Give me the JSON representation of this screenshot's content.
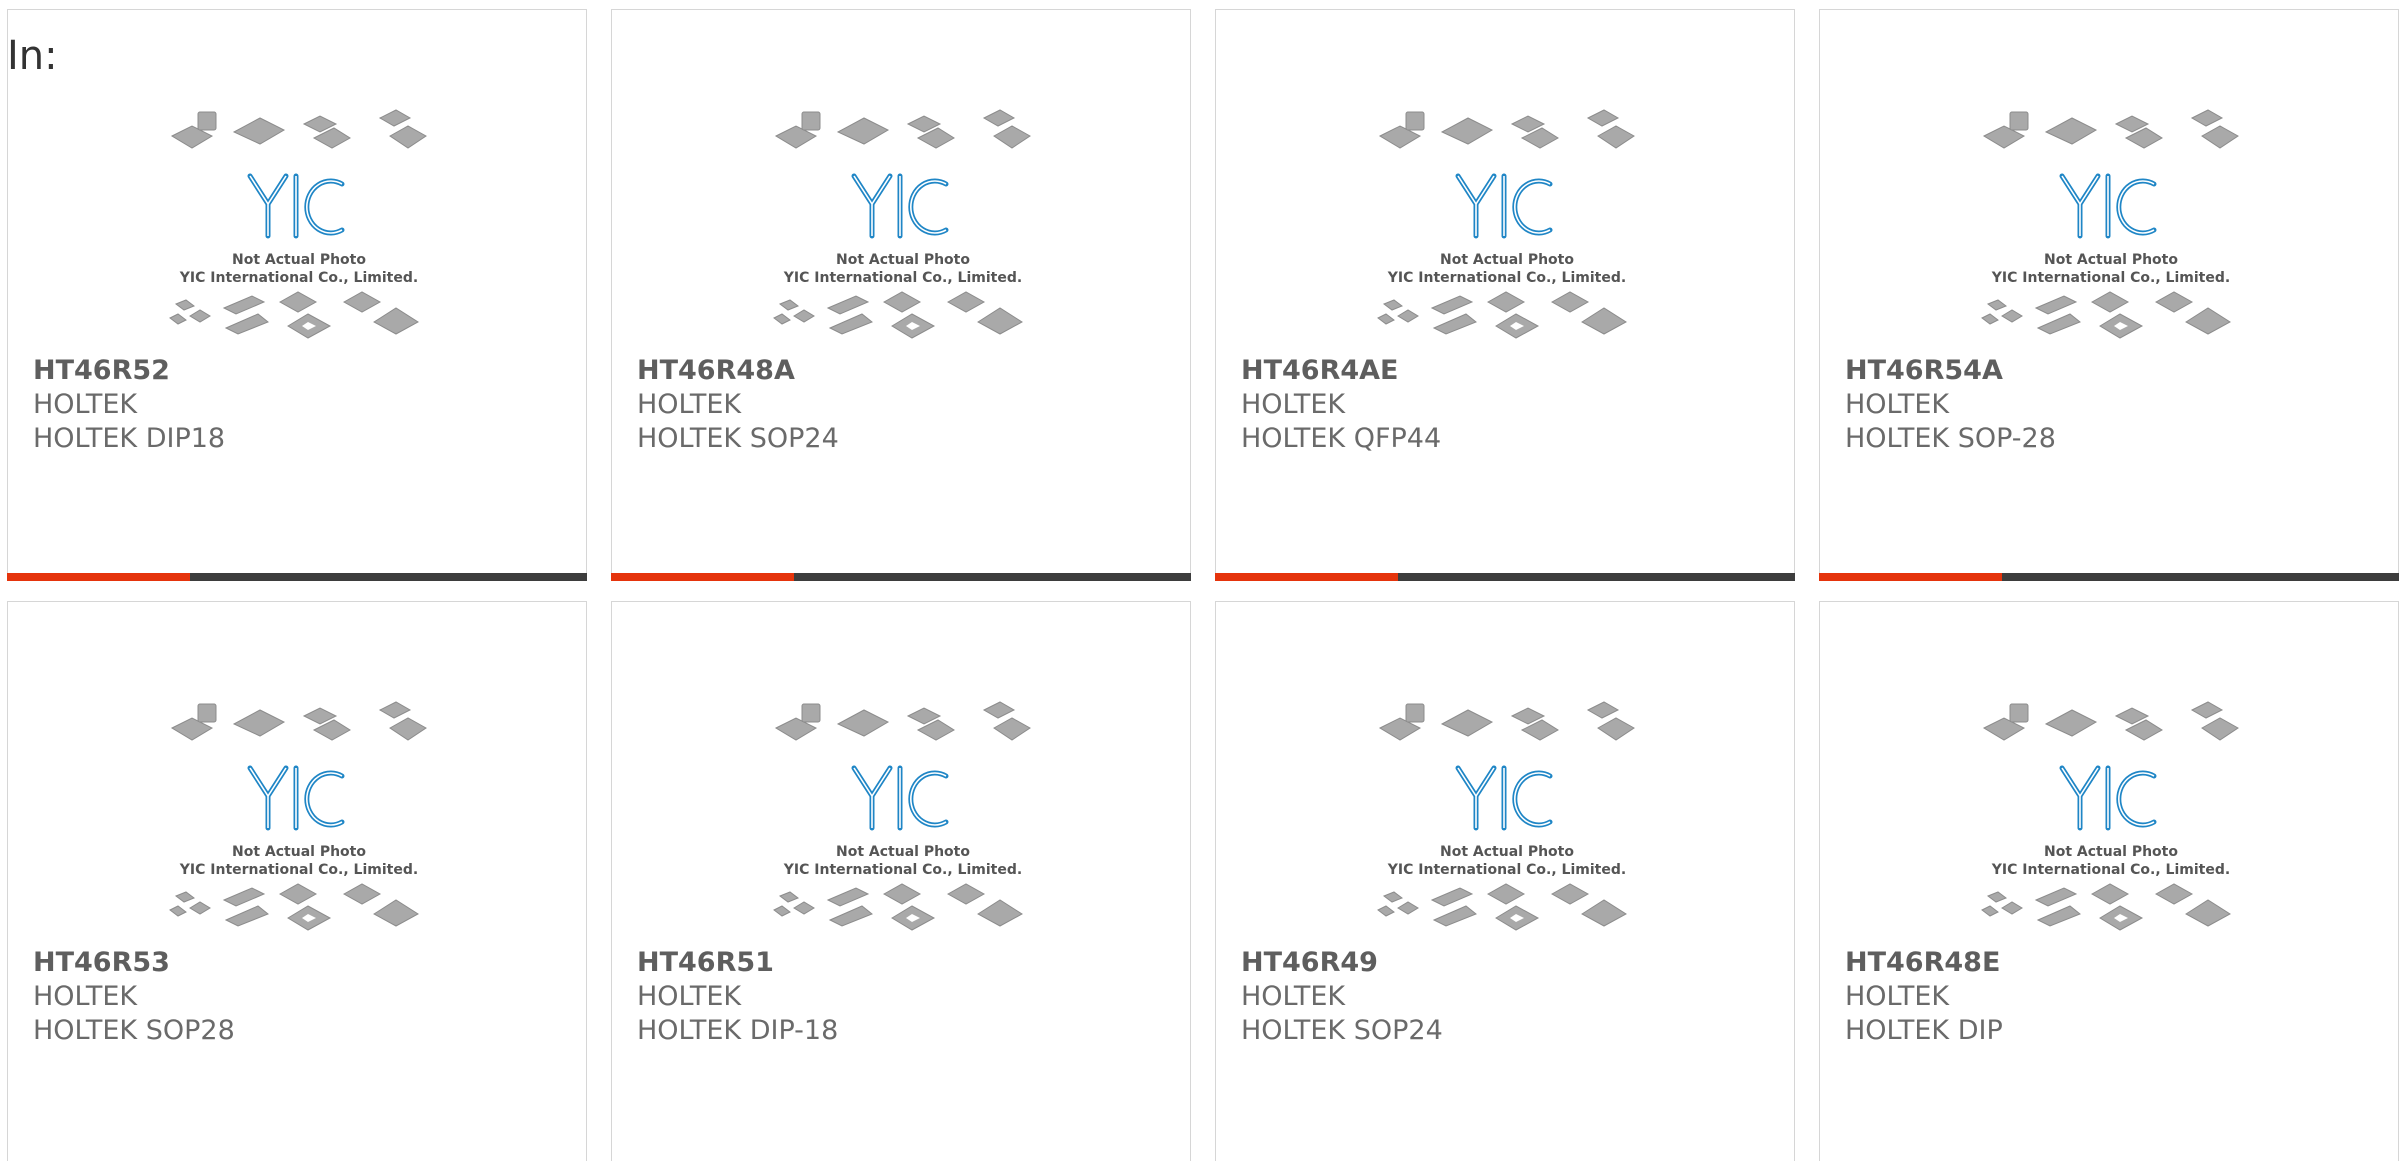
{
  "heading": "In:",
  "watermark": {
    "line1": "Not Actual Photo",
    "line2": "YIC International Co., Limited.",
    "logo": "YIC"
  },
  "colors": {
    "accent": "#e5340c",
    "bar_dark": "#3d3d3d",
    "logo_blue": "#1f86c6"
  },
  "products": [
    {
      "part": "HT46R52",
      "brand": "HOLTEK",
      "package": "HOLTEK DIP18"
    },
    {
      "part": "HT46R48A",
      "brand": "HOLTEK",
      "package": "HOLTEK SOP24"
    },
    {
      "part": "HT46R4AE",
      "brand": "HOLTEK",
      "package": "HOLTEK QFP44"
    },
    {
      "part": "HT46R54A",
      "brand": "HOLTEK",
      "package": "HOLTEK SOP-28"
    },
    {
      "part": "HT46R53",
      "brand": "HOLTEK",
      "package": "HOLTEK SOP28"
    },
    {
      "part": "HT46R51",
      "brand": "HOLTEK",
      "package": "HOLTEK DIP-18"
    },
    {
      "part": "HT46R49",
      "brand": "HOLTEK",
      "package": "HOLTEK SOP24"
    },
    {
      "part": "HT46R48E",
      "brand": "HOLTEK",
      "package": "HOLTEK DIP"
    }
  ]
}
